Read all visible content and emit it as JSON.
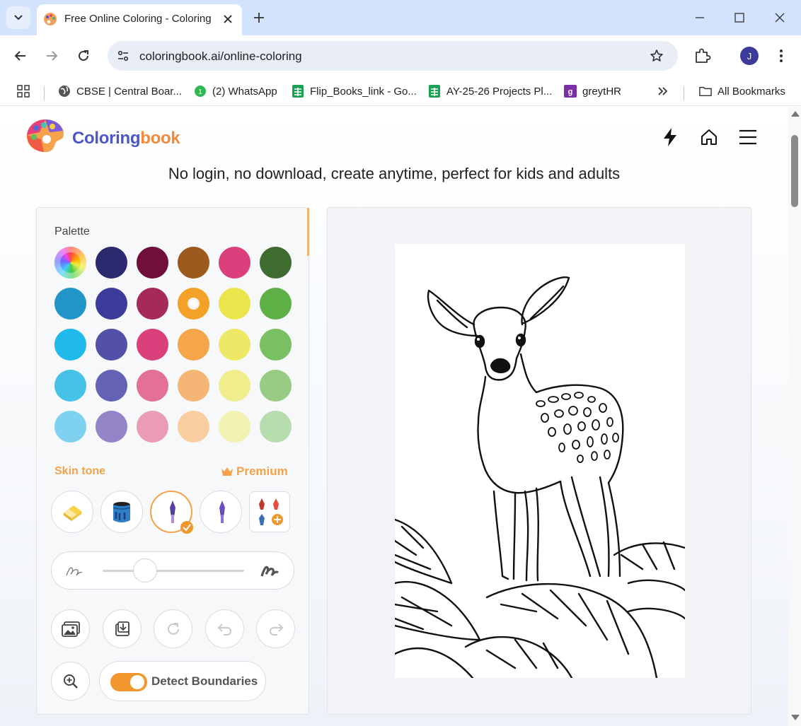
{
  "browser": {
    "tab_title": "Free Online Coloring - Coloring",
    "url": "coloringbook.ai/online-coloring",
    "profile_initial": "J",
    "icons": [
      "tab-search-icon",
      "close-icon",
      "plus-icon",
      "minimize-icon",
      "maximize-icon",
      "close-window-icon",
      "back-icon",
      "forward-icon",
      "reload-icon",
      "site-info-icon",
      "star-icon",
      "extensions-icon",
      "more-icon"
    ]
  },
  "bookmarks": {
    "items": [
      {
        "label": "CBSE | Central Boar...",
        "icon": "globe-icon"
      },
      {
        "label": "(2) WhatsApp",
        "icon": "whatsapp-icon"
      },
      {
        "label": "Flip_Books_link - Go...",
        "icon": "sheets-icon"
      },
      {
        "label": "AY-25-26 Projects Pl...",
        "icon": "sheets-icon"
      },
      {
        "label": "greytHR",
        "icon": "greythr-icon"
      }
    ],
    "all_label": "All Bookmarks"
  },
  "site": {
    "brand_part1": "Coloring",
    "brand_part2": "book",
    "tagline": "No login, no download, create anytime, perfect for kids and adults",
    "header_icons": [
      "bolt-icon",
      "home-icon",
      "menu-icon"
    ]
  },
  "palette": {
    "label": "Palette",
    "selected": "#f4a128",
    "rows": [
      [
        "rainbow",
        "#2b2a6e",
        "#6f0f3a",
        "#9c5a1c",
        "#db3f7c",
        "#3e6b2e"
      ],
      [
        "#2194c8",
        "#3b3b9a",
        "#a52a5a",
        "#f4a128",
        "#e9e54a",
        "#5db046"
      ],
      [
        "#1fb9ec",
        "#5350a8",
        "#d9407c",
        "#f5a54a",
        "#ede966",
        "#79c062"
      ],
      [
        "#46c2e8",
        "#6462b5",
        "#e46f97",
        "#f5b675",
        "#f0ed8c",
        "#98cc85"
      ],
      [
        "#7ed2f0",
        "#9385c8",
        "#eb9bb8",
        "#f8cda0",
        "#f3f2b2",
        "#b7dcae"
      ]
    ]
  },
  "skin_tone": {
    "label": "Skin tone",
    "premium": "Premium"
  },
  "tools": [
    {
      "name": "eraser",
      "selected": false
    },
    {
      "name": "paint-bucket",
      "selected": false
    },
    {
      "name": "brush",
      "selected": true
    },
    {
      "name": "brush-2",
      "selected": false
    },
    {
      "name": "more-tools",
      "selected": false
    }
  ],
  "brush_size": 0.3,
  "detect": {
    "label": "Detect Boundaries",
    "on": true
  },
  "colors": {
    "accent": "#f2962e",
    "brand_blue": "#4b56c8",
    "brand_orange": "#f08a3c"
  }
}
